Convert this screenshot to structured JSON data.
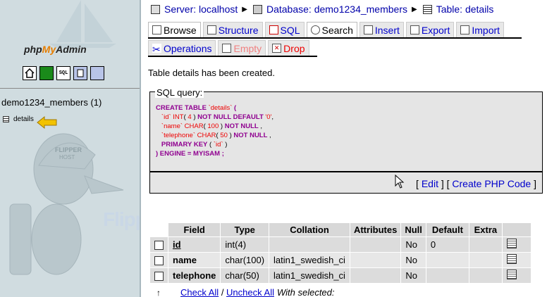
{
  "sidebar": {
    "logo_prefix": "php",
    "logo_my": "My",
    "logo_suffix": "Admin",
    "icons": [
      "home-icon",
      "query-window-icon",
      "sql-icon",
      "docs-icon",
      "sql-docs-icon"
    ],
    "icon_texts": [
      "",
      "",
      "SQL",
      "",
      ""
    ],
    "db_label": "demo1234_members (1)",
    "tables": [
      {
        "name": "details"
      }
    ],
    "watermark": "FlipperHost"
  },
  "breadcrumb": {
    "server": "Server: localhost",
    "database": "Database: demo1234_members",
    "table": "Table: details"
  },
  "tabs_row1": [
    {
      "label": "Browse",
      "icon": "browse-icon",
      "active": true
    },
    {
      "label": "Structure",
      "icon": "structure-icon",
      "active": false
    },
    {
      "label": "SQL",
      "icon": "sql-icon",
      "active": false
    },
    {
      "label": "Search",
      "icon": "search-icon",
      "active": false
    },
    {
      "label": "Insert",
      "icon": "insert-icon",
      "active": false
    },
    {
      "label": "Export",
      "icon": "export-icon",
      "active": false
    },
    {
      "label": "Import",
      "icon": "import-icon",
      "active": false
    }
  ],
  "tabs_row2": [
    {
      "label": "Operations",
      "icon": "operations-icon"
    },
    {
      "label": "Empty",
      "icon": "empty-icon"
    },
    {
      "label": "Drop",
      "icon": "drop-icon"
    }
  ],
  "message": "Table details has been created.",
  "sql_query": {
    "legend": "SQL query:",
    "lines": [
      "CREATE TABLE `details` (",
      "`id` INT( 4 ) NOT NULL DEFAULT '0',",
      "`name` CHAR( 100 ) NOT NULL ,",
      "`telephone` CHAR( 50 ) NOT NULL ,",
      "PRIMARY KEY ( `id` )",
      ") ENGINE = MYISAM ;"
    ],
    "edit_label": "Edit",
    "php_label": "Create PHP Code"
  },
  "structure_table": {
    "headers": [
      "Field",
      "Type",
      "Collation",
      "Attributes",
      "Null",
      "Default",
      "Extra"
    ],
    "rows": [
      {
        "field": "id",
        "type": "int(4)",
        "collation": "",
        "attributes": "",
        "null": "No",
        "default": "0",
        "extra": "",
        "primary": true
      },
      {
        "field": "name",
        "type": "char(100)",
        "collation": "latin1_swedish_ci",
        "attributes": "",
        "null": "No",
        "default": "",
        "extra": "",
        "primary": false
      },
      {
        "field": "telephone",
        "type": "char(50)",
        "collation": "latin1_swedish_ci",
        "attributes": "",
        "null": "No",
        "default": "",
        "extra": "",
        "primary": false
      }
    ],
    "check_all": "Check All",
    "uncheck_all": "Uncheck All",
    "with_selected": "With selected:"
  },
  "colors": {
    "link": "#0000cc",
    "sidebar_bg": "#d0dce0",
    "sql_keyword": "#900090",
    "sql_function": "#ee0000"
  }
}
